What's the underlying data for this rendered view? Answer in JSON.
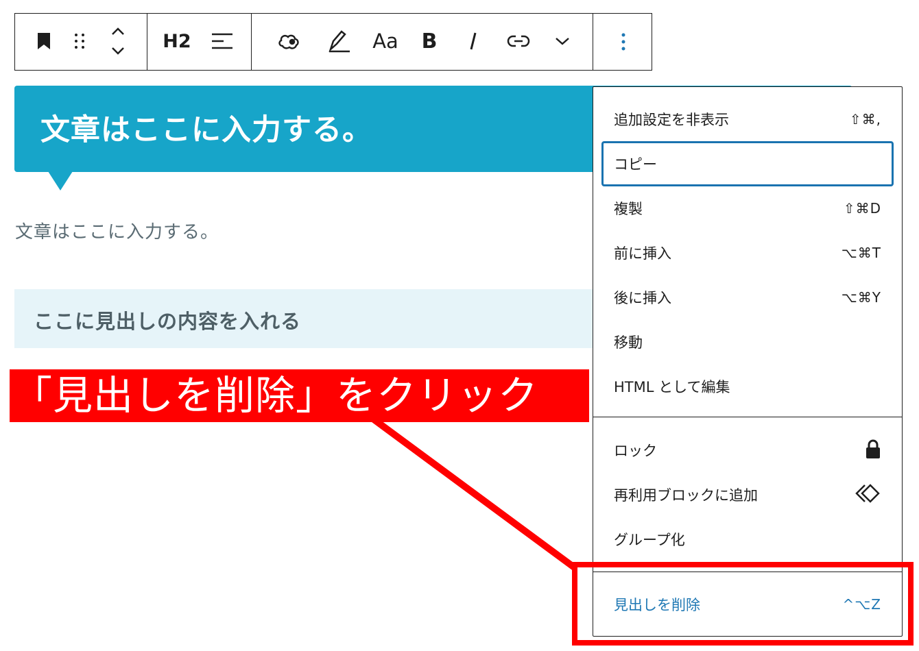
{
  "toolbar": {
    "heading_level": "H2"
  },
  "content": {
    "balloon_text": "文章はここに入力する。",
    "paragraph_text": "文章はここに入力する。",
    "subheading_text": "ここに見出しの内容を入れる"
  },
  "annotation": {
    "text": "「見出しを削除」をクリック",
    "color": "#ff0000"
  },
  "menu": {
    "group1": [
      {
        "label": "追加設定を非表示",
        "shortcut": "⇧⌘,"
      },
      {
        "label": "コピー",
        "shortcut": ""
      },
      {
        "label": "複製",
        "shortcut": "⇧⌘D"
      },
      {
        "label": "前に挿入",
        "shortcut": "⌥⌘T"
      },
      {
        "label": "後に挿入",
        "shortcut": "⌥⌘Y"
      },
      {
        "label": "移動",
        "shortcut": ""
      },
      {
        "label": "HTML として編集",
        "shortcut": ""
      }
    ],
    "group2": [
      {
        "label": "ロック",
        "icon": "lock-icon"
      },
      {
        "label": "再利用ブロックに追加",
        "icon": "reusable-block-icon"
      },
      {
        "label": "グループ化",
        "icon": ""
      }
    ],
    "remove": {
      "label": "見出しを削除",
      "shortcut": "^⌥Z"
    }
  },
  "colors": {
    "accent": "#17a5c9",
    "subheading_bg": "#e6f4f9",
    "link_blue": "#1f78b4"
  }
}
